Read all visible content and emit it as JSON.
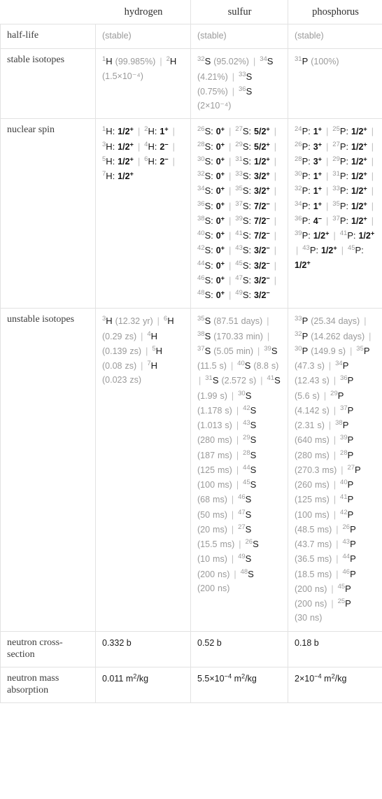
{
  "table": {
    "columns": [
      "",
      "hydrogen",
      "sulfur",
      "phosphorus"
    ],
    "rows": [
      {
        "label": "half-life",
        "cells": [
          {
            "type": "plain",
            "text": "(stable)",
            "muted": true
          },
          {
            "type": "plain",
            "text": "(stable)",
            "muted": true
          },
          {
            "type": "plain",
            "text": "(stable)",
            "muted": true
          }
        ]
      },
      {
        "label": "stable isotopes",
        "cells": [
          {
            "type": "isotope_list",
            "items": [
              {
                "mass": "1",
                "symbol": "H",
                "value": "(99.985%)"
              },
              {
                "mass": "2",
                "symbol": "H",
                "value": "(1.5×10⁻⁴)"
              }
            ]
          },
          {
            "type": "isotope_list",
            "items": [
              {
                "mass": "32",
                "symbol": "S",
                "value": "(95.02%)"
              },
              {
                "mass": "34",
                "symbol": "S",
                "value": "(4.21%)"
              },
              {
                "mass": "33",
                "symbol": "S",
                "value": "(0.75%)"
              },
              {
                "mass": "36",
                "symbol": "S",
                "value": "(2×10⁻⁴)"
              }
            ]
          },
          {
            "type": "isotope_list",
            "items": [
              {
                "mass": "31",
                "symbol": "P",
                "value": "(100%)"
              }
            ]
          }
        ]
      },
      {
        "label": "nuclear spin",
        "cells": [
          {
            "type": "spin_list",
            "items": [
              {
                "mass": "1",
                "symbol": "H",
                "spin": "1/2",
                "sign": "+"
              },
              {
                "mass": "2",
                "symbol": "H",
                "spin": "1",
                "sign": "+"
              },
              {
                "mass": "3",
                "symbol": "H",
                "spin": "1/2",
                "sign": "+"
              },
              {
                "mass": "4",
                "symbol": "H",
                "spin": "2",
                "sign": "−"
              },
              {
                "mass": "5",
                "symbol": "H",
                "spin": "1/2",
                "sign": "+"
              },
              {
                "mass": "6",
                "symbol": "H",
                "spin": "2",
                "sign": "−"
              },
              {
                "mass": "7",
                "symbol": "H",
                "spin": "1/2",
                "sign": "+"
              }
            ]
          },
          {
            "type": "spin_list",
            "items": [
              {
                "mass": "26",
                "symbol": "S",
                "spin": "0",
                "sign": "+"
              },
              {
                "mass": "27",
                "symbol": "S",
                "spin": "5/2",
                "sign": "+"
              },
              {
                "mass": "28",
                "symbol": "S",
                "spin": "0",
                "sign": "+"
              },
              {
                "mass": "29",
                "symbol": "S",
                "spin": "5/2",
                "sign": "+"
              },
              {
                "mass": "30",
                "symbol": "S",
                "spin": "0",
                "sign": "+"
              },
              {
                "mass": "31",
                "symbol": "S",
                "spin": "1/2",
                "sign": "+"
              },
              {
                "mass": "32",
                "symbol": "S",
                "spin": "0",
                "sign": "+"
              },
              {
                "mass": "33",
                "symbol": "S",
                "spin": "3/2",
                "sign": "+"
              },
              {
                "mass": "34",
                "symbol": "S",
                "spin": "0",
                "sign": "+"
              },
              {
                "mass": "35",
                "symbol": "S",
                "spin": "3/2",
                "sign": "+"
              },
              {
                "mass": "36",
                "symbol": "S",
                "spin": "0",
                "sign": "+"
              },
              {
                "mass": "37",
                "symbol": "S",
                "spin": "7/2",
                "sign": "−"
              },
              {
                "mass": "38",
                "symbol": "S",
                "spin": "0",
                "sign": "+"
              },
              {
                "mass": "39",
                "symbol": "S",
                "spin": "7/2",
                "sign": "−"
              },
              {
                "mass": "40",
                "symbol": "S",
                "spin": "0",
                "sign": "+"
              },
              {
                "mass": "41",
                "symbol": "S",
                "spin": "7/2",
                "sign": "−"
              },
              {
                "mass": "42",
                "symbol": "S",
                "spin": "0",
                "sign": "+"
              },
              {
                "mass": "43",
                "symbol": "S",
                "spin": "3/2",
                "sign": "−"
              },
              {
                "mass": "44",
                "symbol": "S",
                "spin": "0",
                "sign": "+"
              },
              {
                "mass": "45",
                "symbol": "S",
                "spin": "3/2",
                "sign": "−"
              },
              {
                "mass": "46",
                "symbol": "S",
                "spin": "0",
                "sign": "+"
              },
              {
                "mass": "47",
                "symbol": "S",
                "spin": "3/2",
                "sign": "−"
              },
              {
                "mass": "48",
                "symbol": "S",
                "spin": "0",
                "sign": "+"
              },
              {
                "mass": "49",
                "symbol": "S",
                "spin": "3/2",
                "sign": "−"
              }
            ]
          },
          {
            "type": "spin_list",
            "items": [
              {
                "mass": "24",
                "symbol": "P",
                "spin": "1",
                "sign": "+"
              },
              {
                "mass": "25",
                "symbol": "P",
                "spin": "1/2",
                "sign": "+"
              },
              {
                "mass": "26",
                "symbol": "P",
                "spin": "3",
                "sign": "+"
              },
              {
                "mass": "27",
                "symbol": "P",
                "spin": "1/2",
                "sign": "+"
              },
              {
                "mass": "28",
                "symbol": "P",
                "spin": "3",
                "sign": "+"
              },
              {
                "mass": "29",
                "symbol": "P",
                "spin": "1/2",
                "sign": "+"
              },
              {
                "mass": "30",
                "symbol": "P",
                "spin": "1",
                "sign": "+"
              },
              {
                "mass": "31",
                "symbol": "P",
                "spin": "1/2",
                "sign": "+"
              },
              {
                "mass": "32",
                "symbol": "P",
                "spin": "1",
                "sign": "+"
              },
              {
                "mass": "33",
                "symbol": "P",
                "spin": "1/2",
                "sign": "+"
              },
              {
                "mass": "34",
                "symbol": "P",
                "spin": "1",
                "sign": "+"
              },
              {
                "mass": "35",
                "symbol": "P",
                "spin": "1/2",
                "sign": "+"
              },
              {
                "mass": "36",
                "symbol": "P",
                "spin": "4",
                "sign": "−"
              },
              {
                "mass": "37",
                "symbol": "P",
                "spin": "1/2",
                "sign": "+"
              },
              {
                "mass": "39",
                "symbol": "P",
                "spin": "1/2",
                "sign": "+"
              },
              {
                "mass": "41",
                "symbol": "P",
                "spin": "1/2",
                "sign": "+"
              },
              {
                "mass": "43",
                "symbol": "P",
                "spin": "1/2",
                "sign": "+"
              },
              {
                "mass": "45",
                "symbol": "P",
                "spin": "1/2",
                "sign": "+"
              }
            ]
          }
        ]
      },
      {
        "label": "unstable isotopes",
        "cells": [
          {
            "type": "isotope_list",
            "items": [
              {
                "mass": "3",
                "symbol": "H",
                "value": "(12.32 yr)"
              },
              {
                "mass": "6",
                "symbol": "H",
                "value": "(0.29 zs)"
              },
              {
                "mass": "4",
                "symbol": "H",
                "value": "(0.139 zs)"
              },
              {
                "mass": "5",
                "symbol": "H",
                "value": "(0.08 zs)"
              },
              {
                "mass": "7",
                "symbol": "H",
                "value": "(0.023 zs)"
              }
            ]
          },
          {
            "type": "isotope_list",
            "items": [
              {
                "mass": "35",
                "symbol": "S",
                "value": "(87.51 days)"
              },
              {
                "mass": "38",
                "symbol": "S",
                "value": "(170.33 min)"
              },
              {
                "mass": "37",
                "symbol": "S",
                "value": "(5.05 min)"
              },
              {
                "mass": "39",
                "symbol": "S",
                "value": "(11.5 s)"
              },
              {
                "mass": "40",
                "symbol": "S",
                "value": "(8.8 s)"
              },
              {
                "mass": "31",
                "symbol": "S",
                "value": "(2.572 s)"
              },
              {
                "mass": "41",
                "symbol": "S",
                "value": "(1.99 s)"
              },
              {
                "mass": "30",
                "symbol": "S",
                "value": "(1.178 s)"
              },
              {
                "mass": "42",
                "symbol": "S",
                "value": "(1.013 s)"
              },
              {
                "mass": "43",
                "symbol": "S",
                "value": "(280 ms)"
              },
              {
                "mass": "29",
                "symbol": "S",
                "value": "(187 ms)"
              },
              {
                "mass": "28",
                "symbol": "S",
                "value": "(125 ms)"
              },
              {
                "mass": "44",
                "symbol": "S",
                "value": "(100 ms)"
              },
              {
                "mass": "45",
                "symbol": "S",
                "value": "(68 ms)"
              },
              {
                "mass": "46",
                "symbol": "S",
                "value": "(50 ms)"
              },
              {
                "mass": "47",
                "symbol": "S",
                "value": "(20 ms)"
              },
              {
                "mass": "27",
                "symbol": "S",
                "value": "(15.5 ms)"
              },
              {
                "mass": "26",
                "symbol": "S",
                "value": "(10 ms)"
              },
              {
                "mass": "49",
                "symbol": "S",
                "value": "(200 ns)"
              },
              {
                "mass": "48",
                "symbol": "S",
                "value": "(200 ns)"
              }
            ]
          },
          {
            "type": "isotope_list",
            "items": [
              {
                "mass": "33",
                "symbol": "P",
                "value": "(25.34 days)"
              },
              {
                "mass": "32",
                "symbol": "P",
                "value": "(14.262 days)"
              },
              {
                "mass": "30",
                "symbol": "P",
                "value": "(149.9 s)"
              },
              {
                "mass": "35",
                "symbol": "P",
                "value": "(47.3 s)"
              },
              {
                "mass": "34",
                "symbol": "P",
                "value": "(12.43 s)"
              },
              {
                "mass": "36",
                "symbol": "P",
                "value": "(5.6 s)"
              },
              {
                "mass": "29",
                "symbol": "P",
                "value": "(4.142 s)"
              },
              {
                "mass": "37",
                "symbol": "P",
                "value": "(2.31 s)"
              },
              {
                "mass": "38",
                "symbol": "P",
                "value": "(640 ms)"
              },
              {
                "mass": "39",
                "symbol": "P",
                "value": "(280 ms)"
              },
              {
                "mass": "28",
                "symbol": "P",
                "value": "(270.3 ms)"
              },
              {
                "mass": "27",
                "symbol": "P",
                "value": "(260 ms)"
              },
              {
                "mass": "40",
                "symbol": "P",
                "value": "(125 ms)"
              },
              {
                "mass": "41",
                "symbol": "P",
                "value": "(100 ms)"
              },
              {
                "mass": "42",
                "symbol": "P",
                "value": "(48.5 ms)"
              },
              {
                "mass": "26",
                "symbol": "P",
                "value": "(43.7 ms)"
              },
              {
                "mass": "43",
                "symbol": "P",
                "value": "(36.5 ms)"
              },
              {
                "mass": "44",
                "symbol": "P",
                "value": "(18.5 ms)"
              },
              {
                "mass": "46",
                "symbol": "P",
                "value": "(200 ns)"
              },
              {
                "mass": "45",
                "symbol": "P",
                "value": "(200 ns)"
              },
              {
                "mass": "25",
                "symbol": "P",
                "value": "(30 ns)"
              }
            ]
          }
        ]
      },
      {
        "label": "neutron cross-section",
        "cells": [
          {
            "type": "plain",
            "text": "0.332 b"
          },
          {
            "type": "plain",
            "text": "0.52 b"
          },
          {
            "type": "plain",
            "text": "0.18 b"
          }
        ]
      },
      {
        "label": "neutron mass absorption",
        "cells": [
          {
            "type": "sup_unit",
            "pre": "0.011 m",
            "sup": "2",
            "post": "/kg"
          },
          {
            "type": "sup_unit",
            "pre": "5.5×10",
            "sup": "−4",
            "mid": " m",
            "sup2": "2",
            "post": "/kg"
          },
          {
            "type": "sup_unit",
            "pre": "2×10",
            "sup": "−4",
            "mid": " m",
            "sup2": "2",
            "post": "/kg"
          }
        ]
      }
    ]
  }
}
